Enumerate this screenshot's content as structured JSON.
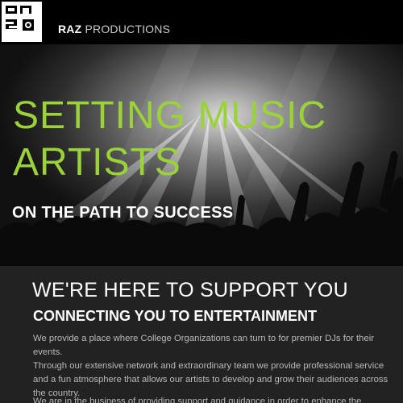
{
  "header": {
    "brand_bold": "RAZ",
    "brand_light": " PRODUCTIONS",
    "logo_icon": "raz-logo-icon"
  },
  "hero": {
    "title_line1": "SETTING MUSIC",
    "title_line2": "ARTISTS",
    "subtitle": "ON THE PATH TO SUCCESS",
    "title_color": "#9bd23a",
    "background": "concert crowd under stage lights (grayscale)"
  },
  "content": {
    "heading": "WE'RE HERE TO SUPPORT YOU",
    "subheading": "CONNECTING YOU TO ENTERTAINMENT",
    "paragraphs": [
      "We provide a place where College Organizations can turn to for premier DJs for their events.",
      "Through our extensive network and extraordinary team we provide professional service and a fun atmosphere that allows our artists to develop and grow their audiences across the country.",
      "We are in the business of providing support and guidance in order to enhance the experience and"
    ]
  },
  "colors": {
    "header_bg": "#000000",
    "content_bg": "#222222",
    "accent": "#9bd23a",
    "body_text": "#b9b9b9"
  }
}
